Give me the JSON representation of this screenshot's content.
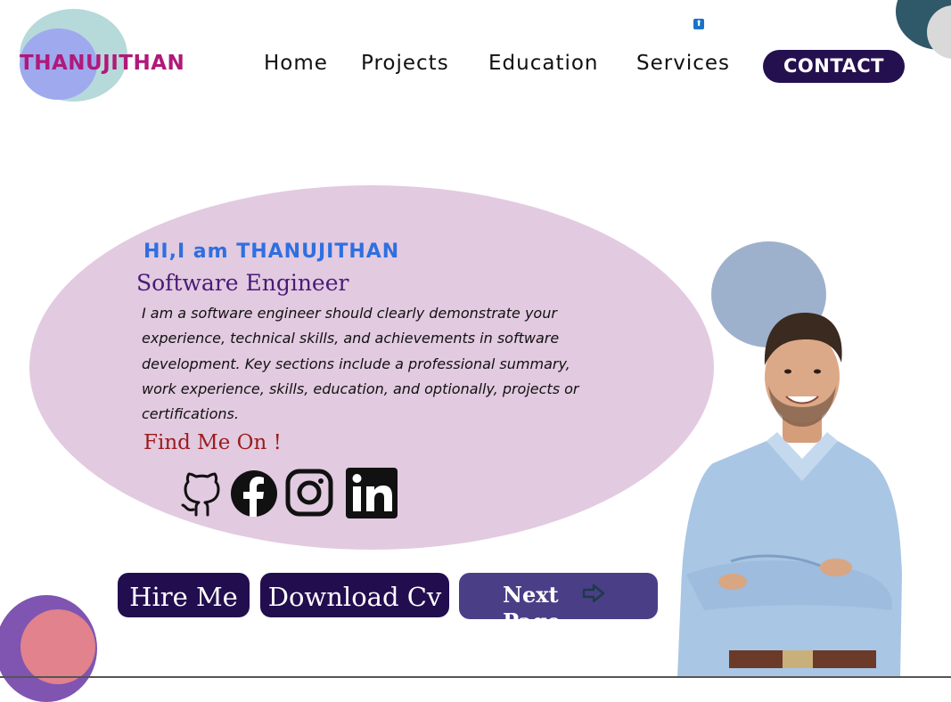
{
  "logo": {
    "text": "THANUJITHAN"
  },
  "nav": {
    "items": [
      {
        "label": "Home"
      },
      {
        "label": "Projects"
      },
      {
        "label": "Education"
      },
      {
        "label": "Services"
      }
    ],
    "contact_label": "CONTACT"
  },
  "hero": {
    "greeting": "HI,I am THANUJITHAN",
    "role": "Software Engineer",
    "bio": "I am a software engineer should clearly demonstrate your experience, technical skills, and achievements in software development. Key sections include a professional summary, work experience, skills, education, and optionally, projects or certifications.",
    "find_me": "Find Me On !"
  },
  "social_icons": [
    "github-icon",
    "facebook-icon",
    "instagram-icon",
    "linkedin-icon"
  ],
  "buttons": {
    "hire": "Hire Me",
    "download": "Download Cv",
    "next": "Next Page"
  },
  "colors": {
    "accent_dark": "#24104f",
    "logo": "#b0197a",
    "greeting": "#2f6fe0",
    "hero_bg": "#e2cae0",
    "find_me": "#9a1c1c"
  }
}
